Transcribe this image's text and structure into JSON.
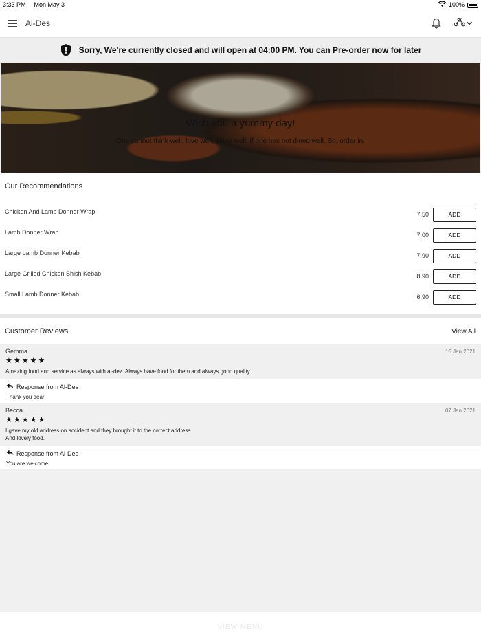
{
  "status_bar": {
    "time": "3:33 PM",
    "date": "Mon May 3",
    "battery": "100%"
  },
  "header": {
    "title": "Al-Des",
    "icons": [
      "menu-icon",
      "bell-icon",
      "scooter-icon",
      "chevron-down-icon"
    ]
  },
  "notice": {
    "text": "Sorry, We're currently closed and will open at 04:00 PM. You can Pre-order now for later",
    "icon": "shield-alert-icon"
  },
  "hero": {
    "title": "Wish you a yummy day!",
    "subtitle": "One cannot think well, love well, sleep well, if one has not dined well. So, order in."
  },
  "recommendations": {
    "title": "Our Recommendations",
    "add_label": "ADD",
    "items": [
      {
        "name": "Chicken And Lamb Donner  Wrap",
        "price": "7.50",
        "add": "ADD"
      },
      {
        "name": "Lamb Donner Wrap",
        "price": "7.00",
        "add": "ADD"
      },
      {
        "name": "Large Lamb Donner Kebab",
        "price": "7.90",
        "add": "ADD"
      },
      {
        "name": "Large Grilled Chicken Shish Kebab",
        "price": "8.90",
        "add": "ADD"
      },
      {
        "name": "Small Lamb Donner Kebab",
        "price": "6.90",
        "add": "ADD"
      }
    ]
  },
  "reviews": {
    "title": "Customer Reviews",
    "view_all": "View All",
    "items": [
      {
        "name": "Gemma",
        "date": "16 Jan 2021",
        "rating": 5,
        "text": "Amazing food and service as always with al-dez. Always have food for them and always good quality",
        "response_label": "Response from Al-Des",
        "response_text": "Thank you dear"
      },
      {
        "name": "Becca",
        "date": "07 Jan 2021",
        "rating": 5,
        "text": "I gave my old address on accident and they brought it to the correct address.\nAnd lovely food.",
        "response_label": "Response from Al-Des",
        "response_text": "You are welcome"
      }
    ]
  },
  "footer": {
    "view_menu": "VIEW MENU"
  }
}
